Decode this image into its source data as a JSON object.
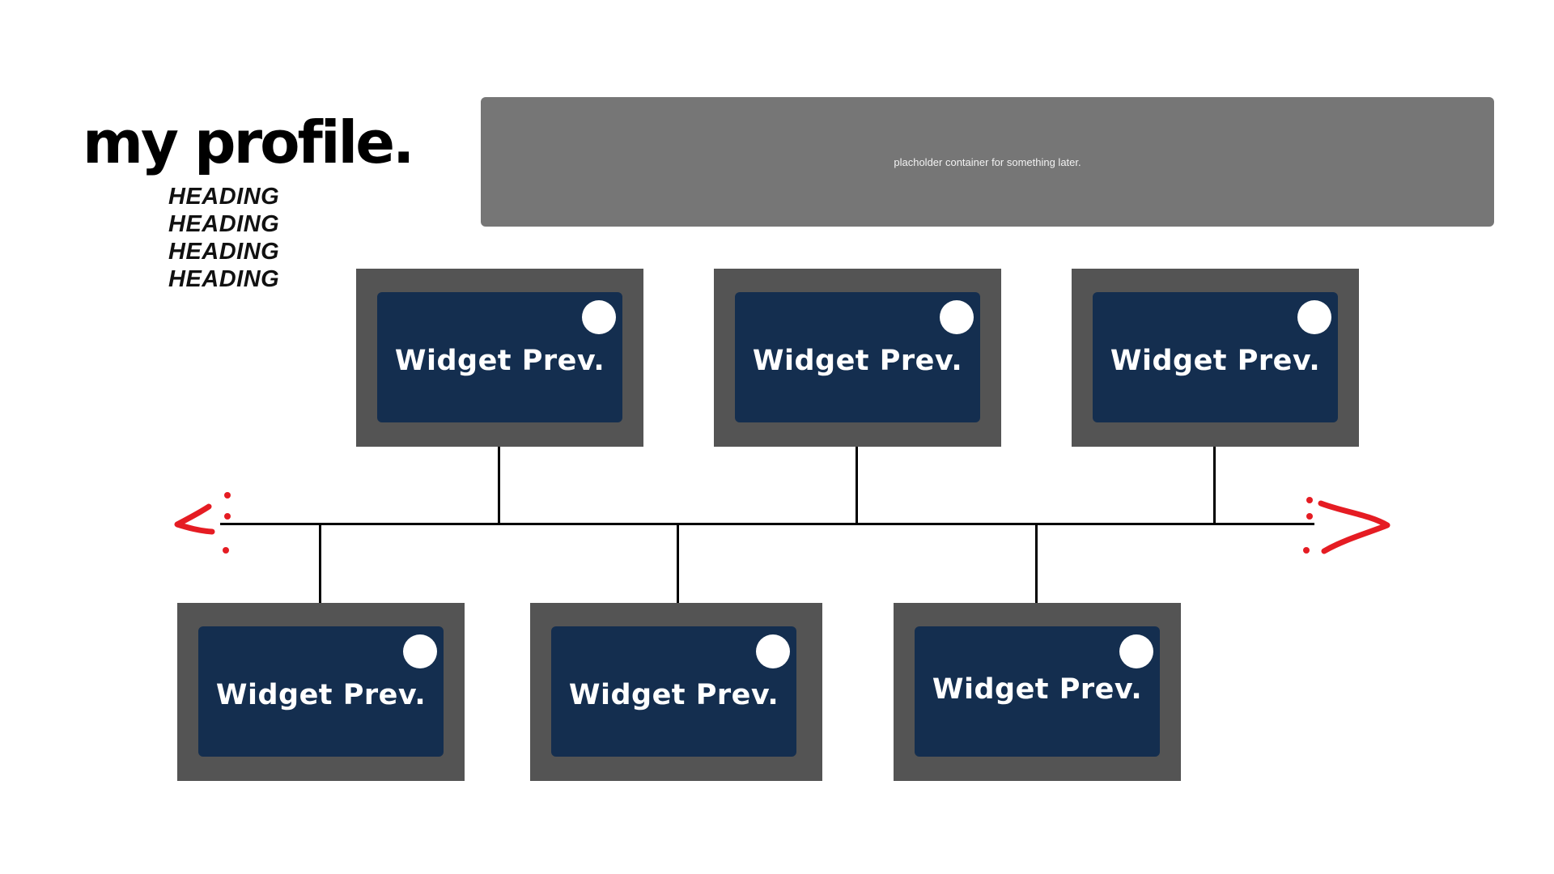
{
  "profile": {
    "title": "my profile.",
    "headings": [
      "HEADING",
      "HEADING",
      "HEADING",
      "HEADING"
    ]
  },
  "placeholder": {
    "text": "placholder container for something later."
  },
  "widgets": {
    "top": [
      {
        "label": "Widget Prev."
      },
      {
        "label": "Widget Prev."
      },
      {
        "label": "Widget Prev."
      }
    ],
    "bottom": [
      {
        "label": "Widget Prev."
      },
      {
        "label": "Widget Prev."
      },
      {
        "label": "Widget Prev."
      }
    ]
  },
  "navigation": {
    "prev_icon": "chevron-left-icon",
    "next_icon": "chevron-right-icon"
  },
  "colors": {
    "frame": "#545454",
    "widget": "#142e4f",
    "placeholder": "#767676",
    "arrow": "#e51c23"
  }
}
